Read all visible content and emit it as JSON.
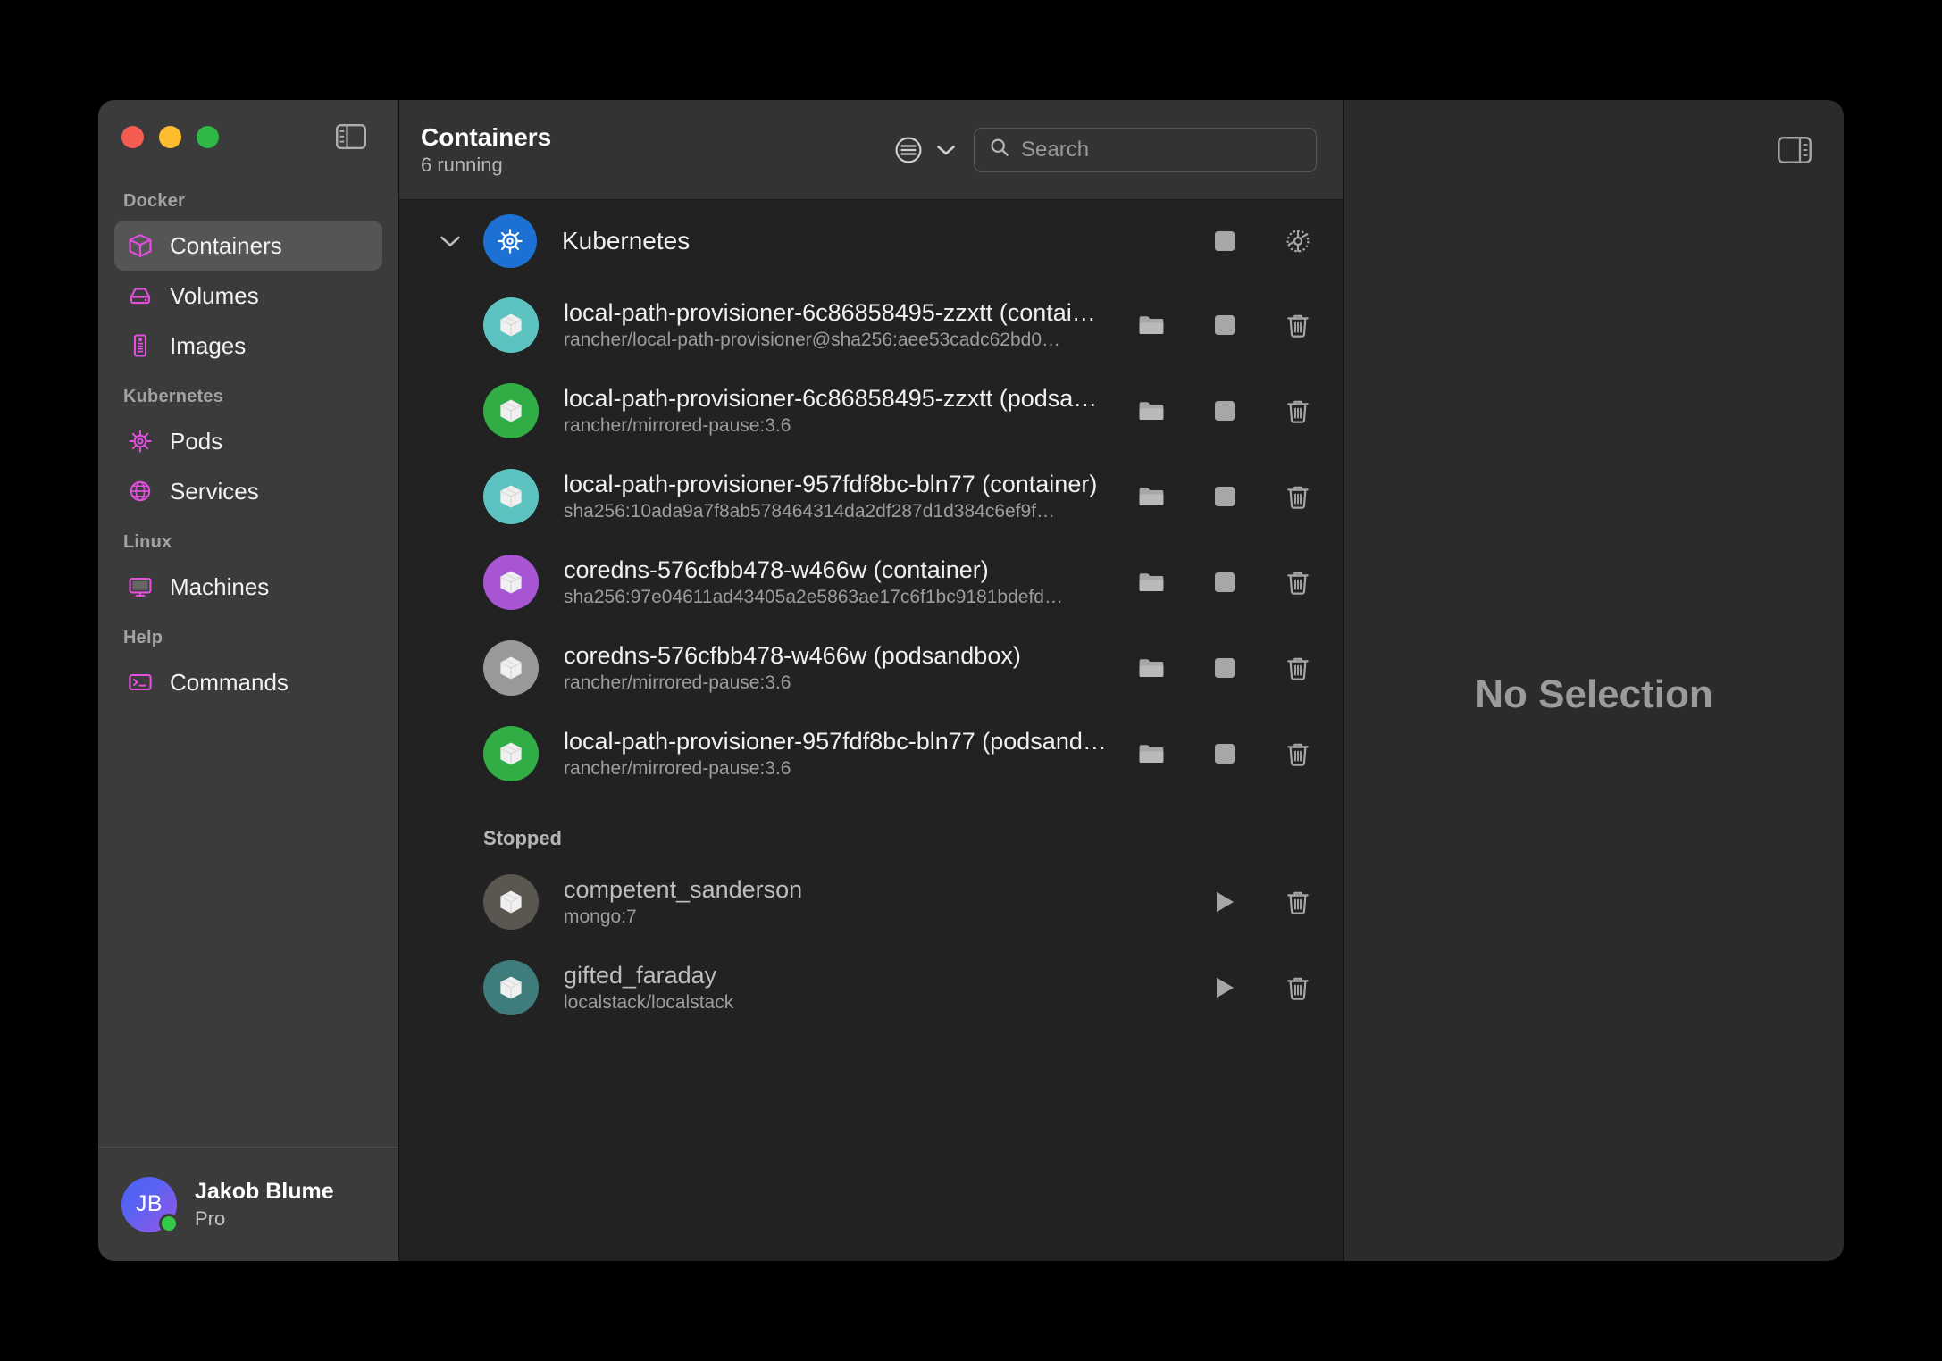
{
  "window": {
    "traffic_lights": [
      "close",
      "minimize",
      "maximize"
    ],
    "sidebar_toggle_icon": "sidebar-left-icon",
    "inspector_toggle_icon": "sidebar-right-icon"
  },
  "sidebar": {
    "sections": [
      {
        "label": "Docker",
        "items": [
          {
            "label": "Containers",
            "icon": "cube-icon",
            "active": true
          },
          {
            "label": "Volumes",
            "icon": "drive-icon",
            "active": false
          },
          {
            "label": "Images",
            "icon": "layers-icon",
            "active": false
          }
        ]
      },
      {
        "label": "Kubernetes",
        "items": [
          {
            "label": "Pods",
            "icon": "helm-wheel-icon",
            "active": false
          },
          {
            "label": "Services",
            "icon": "globe-icon",
            "active": false
          }
        ]
      },
      {
        "label": "Linux",
        "items": [
          {
            "label": "Machines",
            "icon": "monitor-icon",
            "active": false
          }
        ]
      },
      {
        "label": "Help",
        "items": [
          {
            "label": "Commands",
            "icon": "terminal-icon",
            "active": false
          }
        ]
      }
    ],
    "accent_color": "#e44fe0",
    "profile": {
      "initials": "JB",
      "name": "Jakob Blume",
      "plan": "Pro",
      "status_color": "#35c94a"
    }
  },
  "header": {
    "title": "Containers",
    "subtitle": "6 running",
    "filter_icon": "filter-circle-icon",
    "chevron_icon": "chevron-down-icon"
  },
  "search": {
    "placeholder": "Search",
    "value": "",
    "icon": "search-icon"
  },
  "group": {
    "name": "Kubernetes",
    "icon": "helm-wheel-icon",
    "icon_color": "#1e71d4",
    "expanded": true,
    "disclosure_icon": "chevron-down-icon",
    "actions": [
      {
        "name": "stop-button",
        "icon": "stop-square-icon"
      },
      {
        "name": "settings-button",
        "icon": "gear-icon"
      }
    ]
  },
  "running": [
    {
      "title": "local-path-provisioner-6c86858495-zzxtt (contai…",
      "subtitle": "rancher/local-path-provisioner@sha256:aee53cadc62bd0…",
      "color": "#5cc3c0"
    },
    {
      "title": "local-path-provisioner-6c86858495-zzxtt (podsa…",
      "subtitle": "rancher/mirrored-pause:3.6",
      "color": "#31ad46"
    },
    {
      "title": "local-path-provisioner-957fdf8bc-bln77 (container)",
      "subtitle": "sha256:10ada9a7f8ab578464314da2df287d1d384c6ef9f…",
      "color": "#5cc3c0"
    },
    {
      "title": "coredns-576cfbb478-w466w (container)",
      "subtitle": "sha256:97e04611ad43405a2e5863ae17c6f1bc9181bdefd…",
      "color": "#a855d4"
    },
    {
      "title": "coredns-576cfbb478-w466w (podsandbox)",
      "subtitle": "rancher/mirrored-pause:3.6",
      "color": "#9a9a9a"
    },
    {
      "title": "local-path-provisioner-957fdf8bc-bln77 (podsand…",
      "subtitle": "rancher/mirrored-pause:3.6",
      "color": "#31ad46"
    }
  ],
  "running_actions": [
    {
      "name": "open-folder-button",
      "icon": "folder-icon"
    },
    {
      "name": "stop-button",
      "icon": "stop-square-icon"
    },
    {
      "name": "delete-button",
      "icon": "trash-icon"
    }
  ],
  "stopped_section_label": "Stopped",
  "stopped": [
    {
      "title": "competent_sanderson",
      "subtitle": "mongo:7",
      "color": "#5a5750"
    },
    {
      "title": "gifted_faraday",
      "subtitle": "localstack/localstack",
      "color": "#3f7c7c"
    }
  ],
  "stopped_actions": [
    {
      "name": "start-button",
      "icon": "play-icon"
    },
    {
      "name": "delete-button",
      "icon": "trash-icon"
    }
  ],
  "inspector": {
    "empty_message": "No Selection"
  }
}
